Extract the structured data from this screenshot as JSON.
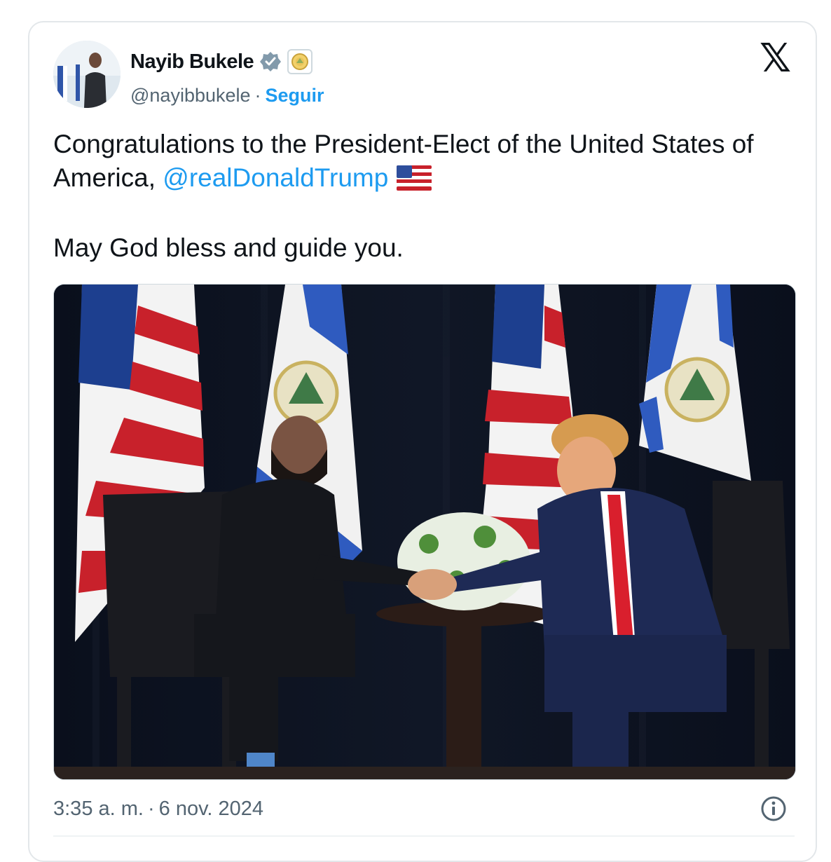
{
  "author": {
    "display_name": "Nayib Bukele",
    "handle": "@nayibbukele",
    "separator": "·",
    "follow_label": "Seguir"
  },
  "brand": {
    "logo_text": "𝕏"
  },
  "tweet": {
    "line1_prefix": "Congratulations to the President-Elect of the United States of America, ",
    "mention": "@realDonaldTrump",
    "line2": "May God bless and guide you."
  },
  "footer": {
    "time": "3:35 a. m.",
    "separator": "·",
    "date": "6 nov. 2024"
  },
  "icons": {
    "verified": "verified-badge-icon",
    "affiliation": "government-seal-icon",
    "flag": "us-flag-icon",
    "info": "info-icon",
    "logo": "x-logo-icon"
  },
  "colors": {
    "link": "#1d9bf0",
    "text": "#0f1419",
    "muted": "#536471",
    "border": "#e3e7ea",
    "flag_blue": "#1d4fb3",
    "flag_white": "#f2f2f2",
    "flag_red": "#c8212b"
  }
}
